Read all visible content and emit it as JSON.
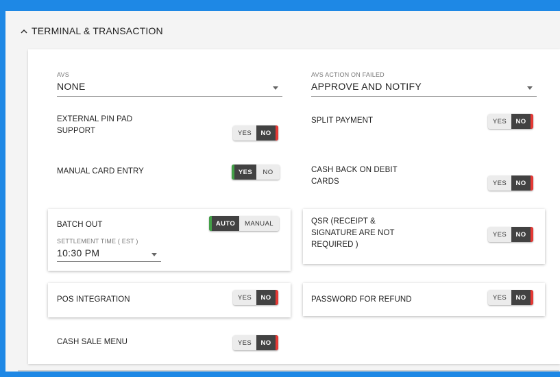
{
  "section": {
    "title": "TERMINAL & TRANSACTION",
    "collapse_icon": "chevron-up-icon"
  },
  "avs": {
    "caption": "AVS",
    "value": "NONE"
  },
  "avs_failed": {
    "caption": "AVS ACTION ON FAILED",
    "value": "APPROVE AND NOTIFY"
  },
  "settings": {
    "external_pin_pad": {
      "label_line1": "EXTERNAL PIN PAD",
      "label_line2": "SUPPORT",
      "yes": "YES",
      "no": "NO",
      "selected": "NO"
    },
    "split_payment": {
      "label": "SPLIT PAYMENT",
      "yes": "YES",
      "no": "NO",
      "selected": "NO"
    },
    "manual_card_entry": {
      "label": "MANUAL CARD ENTRY",
      "yes": "YES",
      "no": "NO",
      "selected": "YES"
    },
    "cash_back": {
      "label_line1": "CASH BACK ON DEBIT",
      "label_line2": "CARDS",
      "yes": "YES",
      "no": "NO",
      "selected": "NO"
    },
    "batch_out": {
      "label": "BATCH OUT",
      "auto": "AUTO",
      "manual": "MANUAL",
      "selected": "AUTO"
    },
    "settlement_time": {
      "caption": "SETTLEMENT TIME ( EST )",
      "value": "10:30 PM"
    },
    "qsr": {
      "label_line1": "QSR (RECEIPT &",
      "label_line2": "SIGNATURE ARE NOT",
      "label_line3": "REQUIRED )",
      "yes": "YES",
      "no": "NO",
      "selected": "NO"
    },
    "pos_integration": {
      "label": "POS INTEGRATION",
      "yes": "YES",
      "no": "NO",
      "selected": "NO"
    },
    "password_refund": {
      "label": "PASSWORD FOR REFUND",
      "yes": "YES",
      "no": "NO",
      "selected": "NO"
    },
    "cash_sale_menu": {
      "label": "CASH SALE MENU",
      "yes": "YES",
      "no": "NO",
      "selected": "NO"
    }
  },
  "colors": {
    "accent_blue": "#1e88e5",
    "toggle_on": "#424242",
    "indicator_no": "#e53935",
    "indicator_yes": "#43a047"
  }
}
